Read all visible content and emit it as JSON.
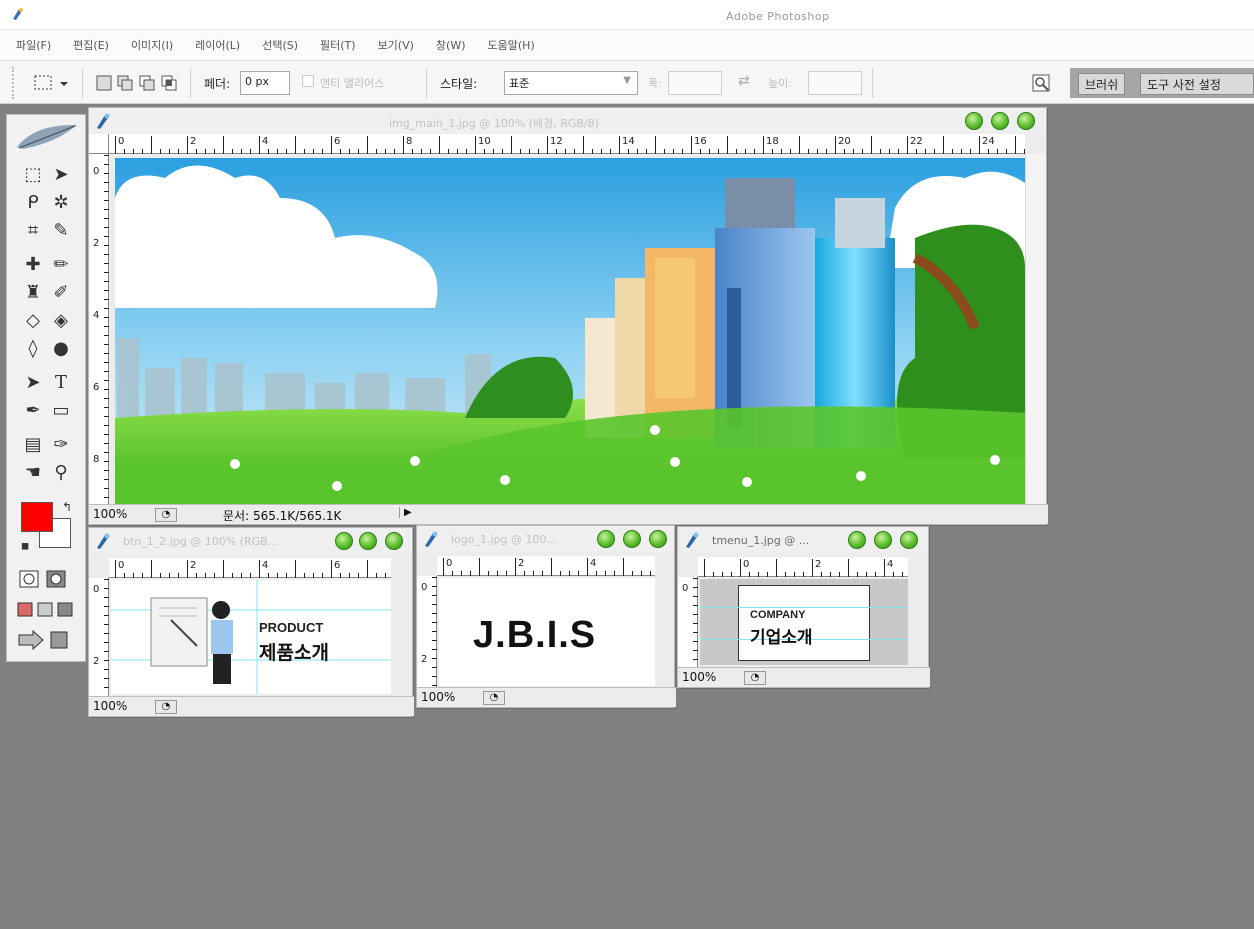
{
  "app": {
    "title": "Adobe Photoshop"
  },
  "menu": [
    "파일(F)",
    "편집(E)",
    "이미지(I)",
    "레이어(L)",
    "선택(S)",
    "필터(T)",
    "보기(V)",
    "창(W)",
    "도움말(H)"
  ],
  "options": {
    "feather_label": "페더:",
    "feather_value": "0 px",
    "antialias_label": "앤티 앨리어스",
    "style_label": "스타일:",
    "style_value": "표준",
    "width_label": "폭:",
    "height_label": "높이:"
  },
  "palette_tabs": [
    "브러쉬",
    "도구 사전 설정"
  ],
  "colors": {
    "foreground": "#ff0000",
    "background": "#ffffff",
    "workspace": "#808080",
    "accent_green": "#5cbd2b"
  },
  "documents": {
    "main": {
      "title": "img_main_1.jpg @ 100% (배경, RGB/8)",
      "zoom": "100%",
      "doc_size": "문서: 565.1K/565.1K",
      "ruler_h": [
        "0",
        "2",
        "4",
        "6",
        "8",
        "10",
        "12",
        "14",
        "16",
        "18",
        "20",
        "22",
        "24"
      ],
      "ruler_v": [
        "0",
        "2",
        "4",
        "6",
        "8"
      ]
    },
    "btn": {
      "title": "btn_1_2.jpg @ 100% (RGB...",
      "zoom": "100%",
      "ruler_h": [
        "0",
        "2",
        "4",
        "6"
      ],
      "ruler_v": [
        "0",
        "2"
      ],
      "text_en": "PRODUCT",
      "text_ko": "제품소개"
    },
    "logo": {
      "title": "logo_1.jpg @ 100...",
      "zoom": "100%",
      "ruler_h": [
        "0",
        "2",
        "4"
      ],
      "ruler_v": [
        "0",
        "2"
      ],
      "text": "J.B.I.S"
    },
    "tmenu": {
      "title": "tmenu_1.jpg @ ...",
      "zoom": "100%",
      "ruler_h": [
        "0",
        "2",
        "4"
      ],
      "ruler_v": [
        "0"
      ],
      "text_en": "COMPANY",
      "text_ko": "기업소개"
    }
  }
}
